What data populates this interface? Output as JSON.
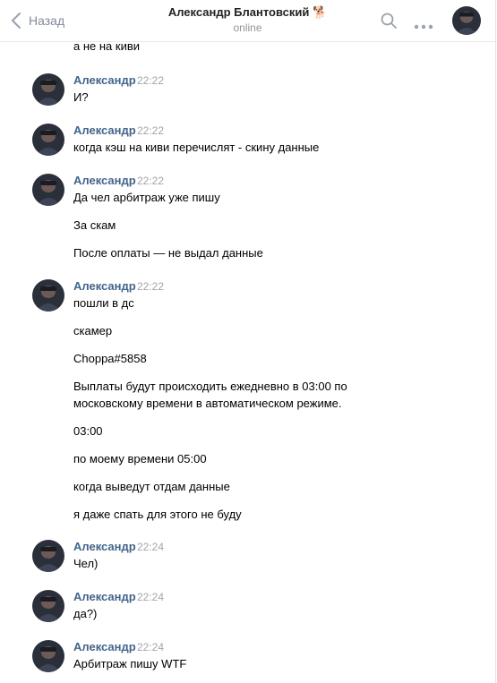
{
  "header": {
    "back_label": "Назад",
    "title": "Александр Блантовский",
    "title_emoji": "🐕",
    "status": "online"
  },
  "icons": {
    "back": "chevron-left-icon",
    "search": "search-icon",
    "more": "more-horizontal-icon"
  },
  "colors": {
    "author": "#42648b",
    "time": "#a0a5ab",
    "muted": "#828a99"
  },
  "history": {
    "prev_tail": "а не на киви",
    "groups": [
      {
        "author": "Александр",
        "time": "22:22",
        "messages": [
          "И?"
        ]
      },
      {
        "author": "Александр",
        "time": "22:22",
        "messages": [
          "когда кэш на киви перечислят - скину данные"
        ]
      },
      {
        "author": "Александр",
        "time": "22:22",
        "messages": [
          "Да чел арбитраж уже пишу",
          "За скам",
          "После оплаты — не выдал данные"
        ]
      },
      {
        "author": "Александр",
        "time": "22:22",
        "messages": [
          "пошли в дс",
          "скамер",
          "Choppa#5858",
          "Выплаты будут происходить ежедневно в 03:00 по",
          "московскому времени в автоматическом режиме.",
          "03:00",
          "по моему времени 05:00",
          "когда выведут отдам данные",
          "я даже спать для этого не буду"
        ]
      },
      {
        "author": "Александр",
        "time": "22:24",
        "messages": [
          "Чел)"
        ]
      },
      {
        "author": "Александр",
        "time": "22:24",
        "messages": [
          "да?)"
        ]
      },
      {
        "author": "Александр",
        "time": "22:24",
        "messages": [
          "Арбитраж пишу WTF"
        ]
      }
    ]
  }
}
